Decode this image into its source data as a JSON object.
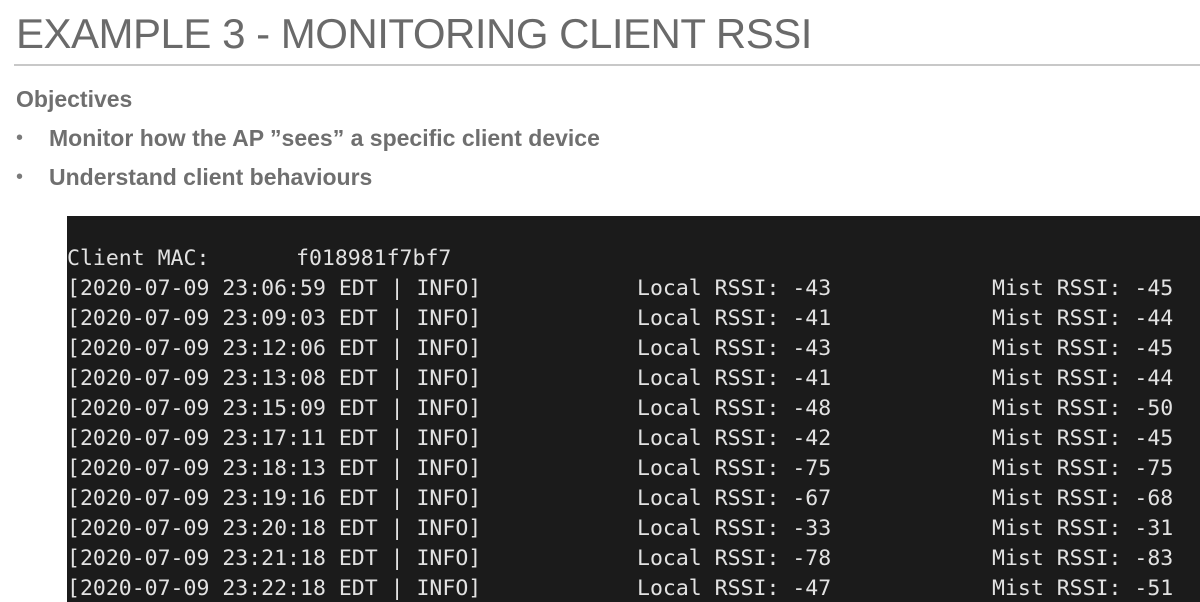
{
  "slide": {
    "title": "EXAMPLE 3 - MONITORING CLIENT RSSI",
    "objectives_heading": "Objectives",
    "bullet_glyph": "•",
    "bullets": [
      "Monitor how the AP ”sees” a specific client device",
      "Understand client behaviours"
    ]
  },
  "terminal": {
    "client_mac_label": "Client MAC:",
    "client_mac_value": "f018981f7bf7",
    "rows": [
      {
        "timestamp": "[2020-07-09 23:06:59 EDT | INFO]",
        "local": "Local RSSI: -43",
        "mist": "Mist RSSI: -45"
      },
      {
        "timestamp": "[2020-07-09 23:09:03 EDT | INFO]",
        "local": "Local RSSI: -41",
        "mist": "Mist RSSI: -44"
      },
      {
        "timestamp": "[2020-07-09 23:12:06 EDT | INFO]",
        "local": "Local RSSI: -43",
        "mist": "Mist RSSI: -45"
      },
      {
        "timestamp": "[2020-07-09 23:13:08 EDT | INFO]",
        "local": "Local RSSI: -41",
        "mist": "Mist RSSI: -44"
      },
      {
        "timestamp": "[2020-07-09 23:15:09 EDT | INFO]",
        "local": "Local RSSI: -48",
        "mist": "Mist RSSI: -50"
      },
      {
        "timestamp": "[2020-07-09 23:17:11 EDT | INFO]",
        "local": "Local RSSI: -42",
        "mist": "Mist RSSI: -45"
      },
      {
        "timestamp": "[2020-07-09 23:18:13 EDT | INFO]",
        "local": "Local RSSI: -75",
        "mist": "Mist RSSI: -75"
      },
      {
        "timestamp": "[2020-07-09 23:19:16 EDT | INFO]",
        "local": "Local RSSI: -67",
        "mist": "Mist RSSI: -68"
      },
      {
        "timestamp": "[2020-07-09 23:20:18 EDT | INFO]",
        "local": "Local RSSI: -33",
        "mist": "Mist RSSI: -31"
      },
      {
        "timestamp": "[2020-07-09 23:21:18 EDT | INFO]",
        "local": "Local RSSI: -78",
        "mist": "Mist RSSI: -83"
      },
      {
        "timestamp": "[2020-07-09 23:22:18 EDT | INFO]",
        "local": "Local RSSI: -47",
        "mist": "Mist RSSI: -51"
      }
    ]
  }
}
